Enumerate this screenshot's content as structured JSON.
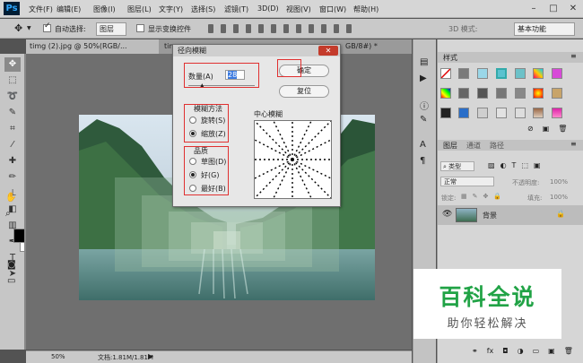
{
  "app": {
    "logo": "Ps",
    "menu": [
      "文件(F)",
      "编辑(E)",
      "图像(I)",
      "图层(L)",
      "文字(Y)",
      "选择(S)",
      "滤镜(T)",
      "3D(D)",
      "视图(V)",
      "窗口(W)",
      "帮助(H)"
    ]
  },
  "options_bar": {
    "auto_select_label": "自动选择:",
    "auto_select_value": "图层",
    "transform_label": "显示变换控件",
    "mode_3d_label": "3D 模式:",
    "workspace": "基本功能"
  },
  "tabs": [
    {
      "label": "timg (2).jpg @ 50%(RGB/..."
    },
    {
      "label": "tim"
    },
    {
      "label": "GB/8#) *"
    }
  ],
  "status": {
    "zoom": "50%",
    "doc_size": "文档:1.81M/1.81M"
  },
  "dialog": {
    "title": "径向模糊",
    "amount_label": "数量(A)",
    "amount_value": "28",
    "ok": "确定",
    "reset": "复位",
    "method_label": "模糊方法",
    "method_options": [
      "旋转(S)",
      "缩放(Z)"
    ],
    "method_selected_index": 1,
    "quality_label": "品质",
    "quality_options": [
      "草图(D)",
      "好(G)",
      "最好(B)"
    ],
    "quality_selected_index": 1,
    "center_label": "中心模糊"
  },
  "right_panel": {
    "styles_tab": "样式",
    "layers_tabs": [
      "图层",
      "通道",
      "路径"
    ],
    "filter_kind": "类型",
    "blend_mode": "正常",
    "opacity_label": "不透明度:",
    "opacity_value": "100%",
    "lock_label": "锁定:",
    "fill_label": "填充:",
    "fill_value": "100%",
    "layer_name": "背景"
  },
  "watermark": {
    "title": "百科全说",
    "subtitle": "助你轻松解决"
  },
  "colors": {
    "accent_red": "#e03030",
    "watermark_green": "#21a346",
    "foreground": "#000000",
    "background": "#ffffff"
  }
}
